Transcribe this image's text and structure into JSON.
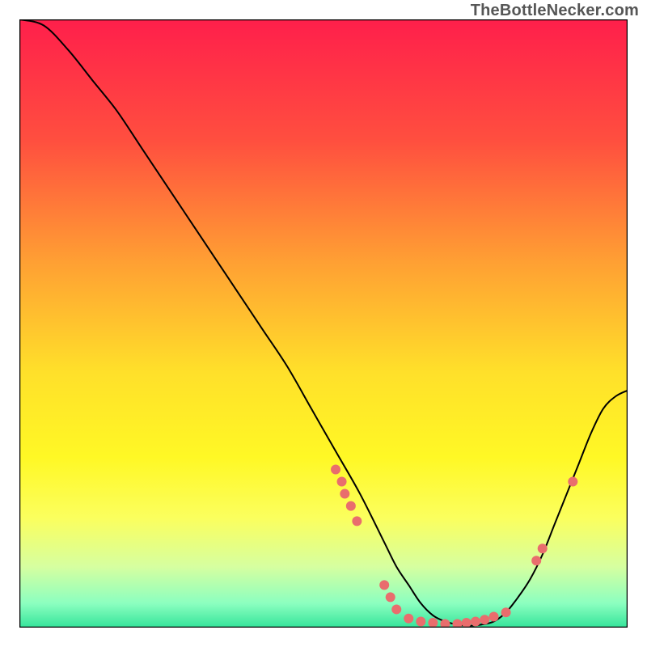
{
  "watermark": "TheBottleNecker.com",
  "chart_data": {
    "type": "line",
    "title": "",
    "xlabel": "",
    "ylabel": "",
    "xlim": [
      0,
      100
    ],
    "ylim": [
      0,
      100
    ],
    "grid": false,
    "legend": false,
    "background_gradient_stops": [
      {
        "offset": 0.0,
        "color": "#ff1f4b"
      },
      {
        "offset": 0.2,
        "color": "#ff4f3f"
      },
      {
        "offset": 0.4,
        "color": "#ffa033"
      },
      {
        "offset": 0.58,
        "color": "#ffe02a"
      },
      {
        "offset": 0.72,
        "color": "#fff825"
      },
      {
        "offset": 0.82,
        "color": "#fbff5e"
      },
      {
        "offset": 0.9,
        "color": "#d6ffa0"
      },
      {
        "offset": 0.96,
        "color": "#8cffc0"
      },
      {
        "offset": 1.0,
        "color": "#35e49a"
      }
    ],
    "series": [
      {
        "name": "bottleneck-curve",
        "color": "#000000",
        "stroke_width": 2,
        "x": [
          0,
          4,
          8,
          12,
          16,
          20,
          24,
          28,
          32,
          36,
          40,
          44,
          48,
          52,
          56,
          60,
          62,
          64,
          66,
          68,
          70,
          72,
          74,
          76,
          78,
          80,
          82,
          84,
          86,
          88,
          90,
          92,
          94,
          96,
          98,
          100
        ],
        "y": [
          100,
          99,
          95,
          90,
          85,
          79,
          73,
          67,
          61,
          55,
          49,
          43,
          36,
          29,
          22,
          14,
          10,
          7,
          4,
          2,
          1,
          0.5,
          0.3,
          0.5,
          1,
          2.5,
          5,
          8,
          12,
          17,
          22,
          27,
          32,
          36,
          38,
          39
        ]
      }
    ],
    "scatter": {
      "name": "benchmark-points",
      "color": "#e96d6d",
      "radius": 6,
      "points": [
        {
          "x": 52,
          "y": 26
        },
        {
          "x": 53,
          "y": 24
        },
        {
          "x": 53.5,
          "y": 22
        },
        {
          "x": 54.5,
          "y": 20
        },
        {
          "x": 55.5,
          "y": 17.5
        },
        {
          "x": 60,
          "y": 7
        },
        {
          "x": 61,
          "y": 5
        },
        {
          "x": 62,
          "y": 3
        },
        {
          "x": 64,
          "y": 1.5
        },
        {
          "x": 66,
          "y": 1
        },
        {
          "x": 68,
          "y": 0.8
        },
        {
          "x": 70,
          "y": 0.6
        },
        {
          "x": 72,
          "y": 0.6
        },
        {
          "x": 73.5,
          "y": 0.8
        },
        {
          "x": 75,
          "y": 1
        },
        {
          "x": 76.5,
          "y": 1.3
        },
        {
          "x": 78,
          "y": 1.8
        },
        {
          "x": 80,
          "y": 2.5
        },
        {
          "x": 85,
          "y": 11
        },
        {
          "x": 86,
          "y": 13
        },
        {
          "x": 91,
          "y": 24
        }
      ]
    }
  }
}
